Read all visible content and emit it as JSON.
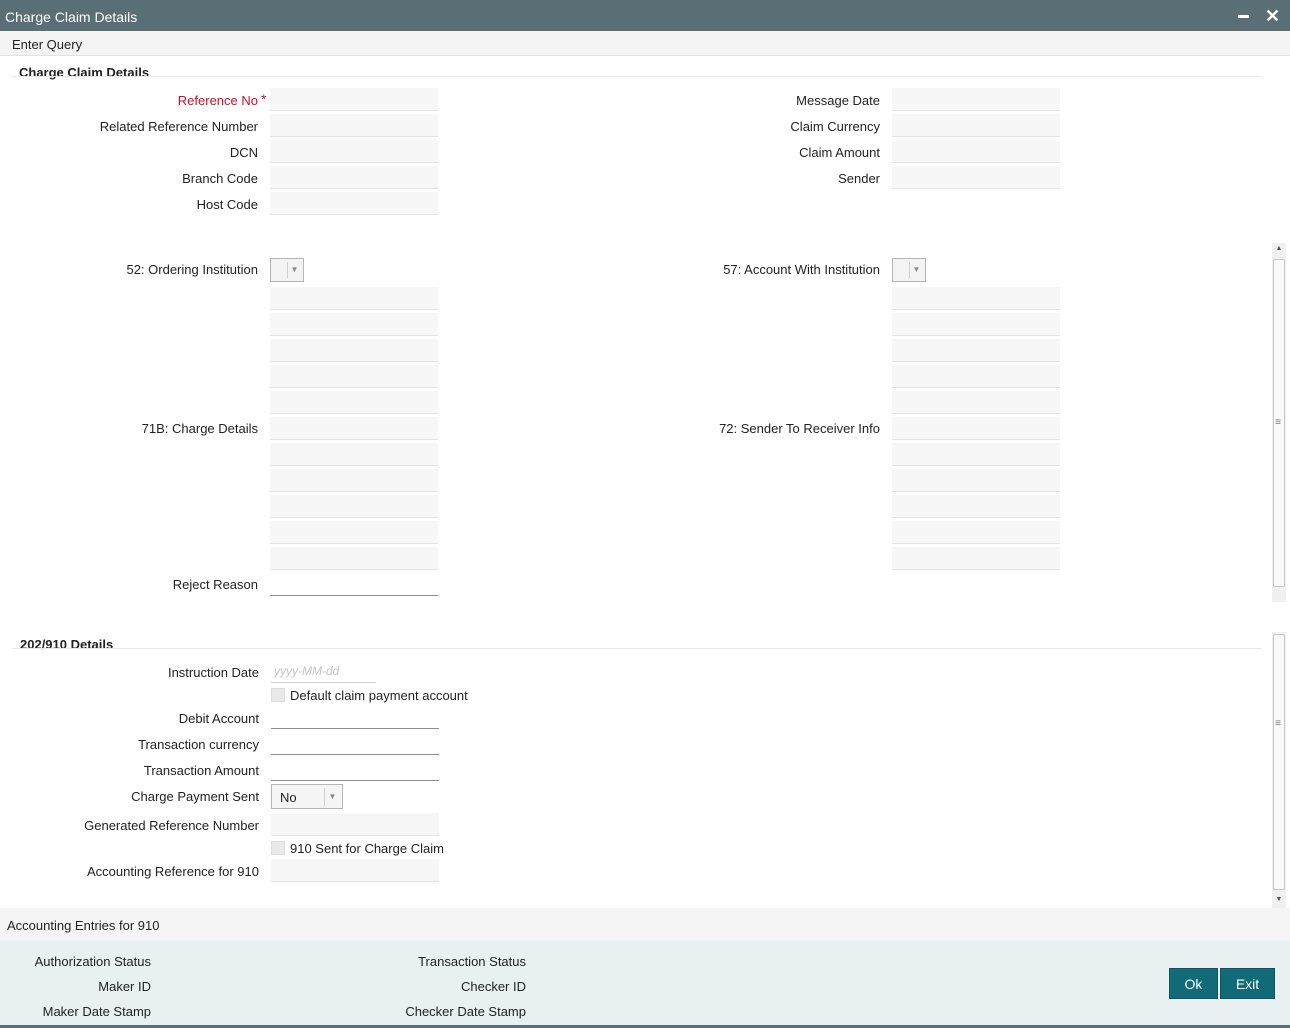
{
  "window": {
    "title": "Charge Claim Details"
  },
  "menu": {
    "enter_query": "Enter Query"
  },
  "header": {
    "section_title": "Charge Claim Details",
    "left": {
      "reference_no": "Reference No",
      "required_mark": "*",
      "related_reference_number": "Related Reference Number",
      "dcn": "DCN",
      "branch_code": "Branch Code",
      "host_code": "Host Code"
    },
    "right": {
      "message_date": "Message Date",
      "claim_currency": "Claim Currency",
      "claim_amount": "Claim Amount",
      "sender": "Sender"
    }
  },
  "swift": {
    "ordering_institution": "52: Ordering Institution",
    "account_with_institution": "57: Account With Institution",
    "charge_details": "71B: Charge Details",
    "sender_to_receiver_info": "72: Sender To Receiver Info",
    "reject_reason": "Reject Reason"
  },
  "details_202_910": {
    "section_title": "202/910 Details",
    "instruction_date": "Instruction Date",
    "instruction_date_placeholder": "yyyy-MM-dd",
    "default_claim_payment_account": "Default claim payment account",
    "debit_account": "Debit Account",
    "transaction_currency": "Transaction currency",
    "transaction_amount": "Transaction Amount",
    "charge_payment_sent": "Charge Payment Sent",
    "charge_payment_sent_value": "No",
    "generated_reference_number": "Generated Reference Number",
    "sent_910_for_charge_claim": "910 Sent for Charge Claim",
    "accounting_reference_for_910": "Accounting Reference for 910"
  },
  "accounting_link": "Accounting Entries for 910",
  "footer": {
    "authorization_status": "Authorization Status",
    "maker_id": "Maker ID",
    "maker_date_stamp": "Maker Date Stamp",
    "transaction_status": "Transaction Status",
    "checker_id": "Checker ID",
    "checker_date_stamp": "Checker Date Stamp",
    "ok": "Ok",
    "exit": "Exit"
  },
  "colors": {
    "titlebar": "#5a6f75",
    "button": "#116a78",
    "required": "#c8102e",
    "footer": "#e8f0f1"
  }
}
